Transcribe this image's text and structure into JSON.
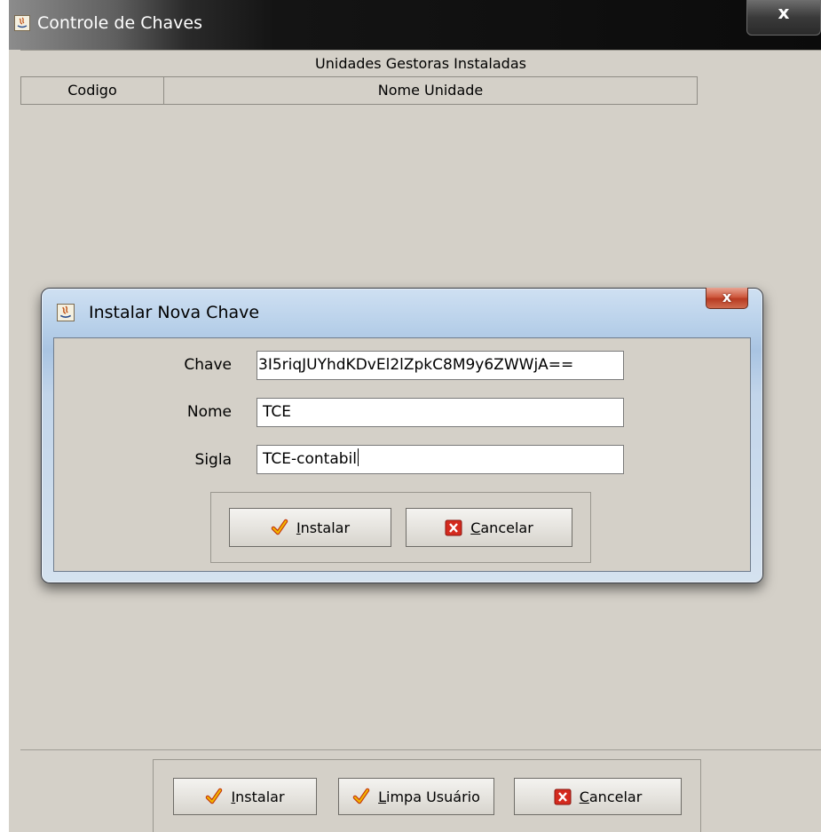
{
  "main_window": {
    "title": "Controle de Chaves",
    "close_symbol": "x",
    "table": {
      "caption": "Unidades Gestoras Instaladas",
      "columns": [
        "Codigo",
        "Nome Unidade"
      ],
      "rows": []
    },
    "buttons": {
      "instalar": {
        "mnemonic": "I",
        "rest": "nstalar",
        "icon": "check-icon"
      },
      "limpa": {
        "mnemonic": "L",
        "rest": "impa Usuário",
        "icon": "check-icon"
      },
      "cancelar": {
        "mnemonic": "C",
        "rest": "ancelar",
        "icon": "red-x-icon"
      }
    }
  },
  "dialog": {
    "title": "Instalar Nova Chave",
    "close_symbol": "x",
    "fields": {
      "chave": {
        "label": "Chave",
        "value": "3I5riqJUYhdKDvEl2lZpkC8M9y6ZWWjA=="
      },
      "nome": {
        "label": "Nome",
        "value": "TCE"
      },
      "sigla": {
        "label": "Sigla",
        "value": "TCE-contabil"
      }
    },
    "buttons": {
      "instalar": {
        "mnemonic": "I",
        "rest": "nstalar",
        "icon": "check-icon"
      },
      "cancelar": {
        "mnemonic": "C",
        "rest": "ancelar",
        "icon": "red-x-icon"
      }
    }
  },
  "colors": {
    "panel": "#d4d0c8",
    "main_titlebar": "#0b0b0b",
    "dialog_frame": "#b9d1ea",
    "dialog_close": "#cf5a3f",
    "check": "#e8a200",
    "cancel_red": "#d42a1e"
  }
}
